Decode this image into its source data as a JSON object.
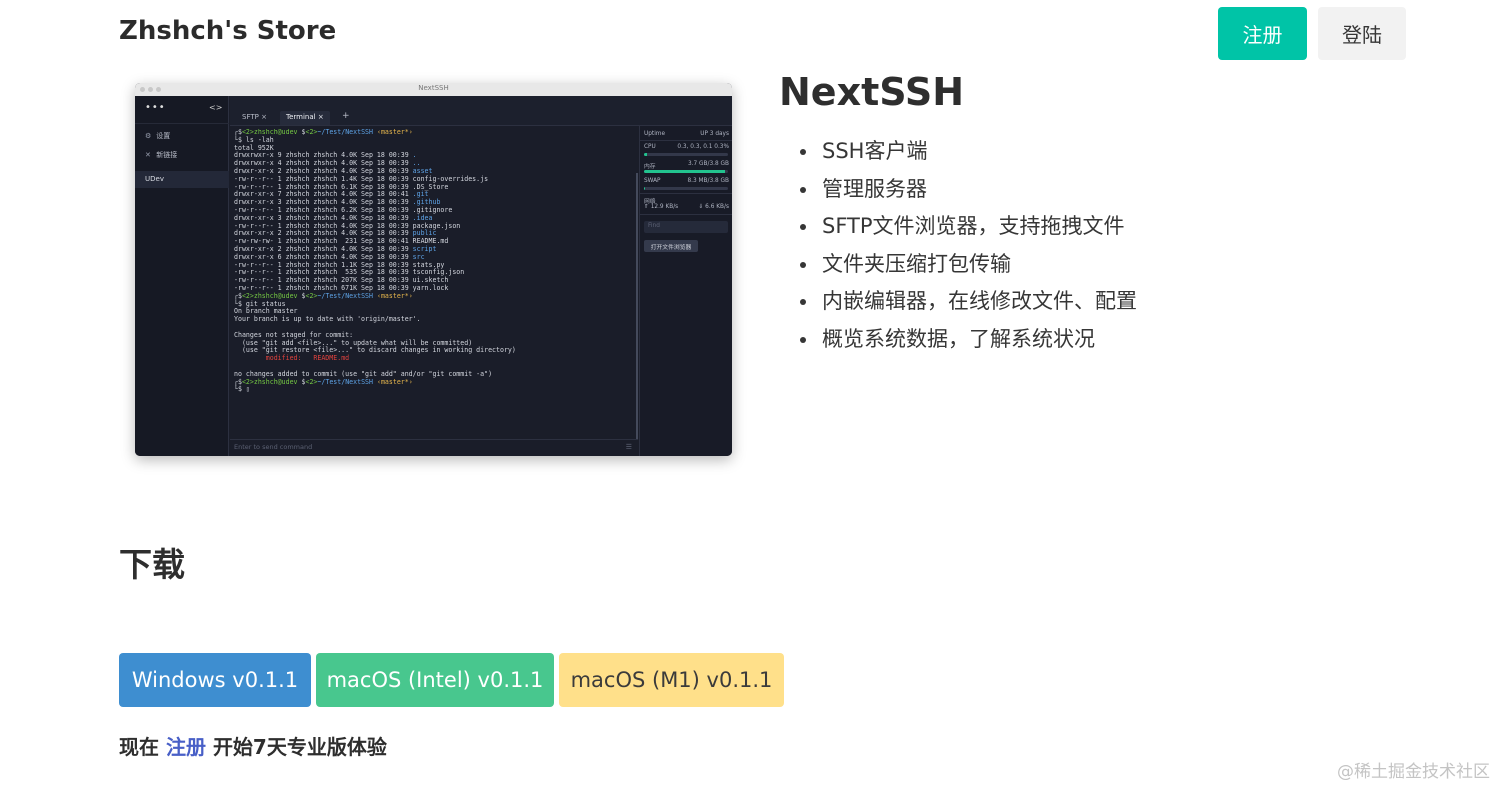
{
  "header": {
    "brand": "Zhshch's Store",
    "register_label": "注册",
    "login_label": "登陆"
  },
  "screenshot": {
    "window_title": "NextSSH",
    "sidebar": {
      "menu_dots": "•••",
      "items": [
        {
          "icon": "gear-icon",
          "label": "设置"
        },
        {
          "icon": "link-icon",
          "label": "新链接"
        }
      ],
      "connection": "UDev"
    },
    "tabs": [
      {
        "label": "SFTP",
        "close": "×"
      },
      {
        "label": "Terminal",
        "close": "×"
      }
    ],
    "add_tab": "+",
    "input_placeholder": "Enter to send command",
    "panel": {
      "uptime_label": "Uptime",
      "uptime_value": "UP 3 days",
      "cpu_label": "CPU",
      "cpu_value": "0.3, 0.3, 0.1 0.3%",
      "cpu_level": 0.03,
      "mem_label": "内存",
      "mem_value": "3.7 GB/3.8 GB",
      "mem_level": 0.97,
      "swap_label": "SWAP",
      "swap_value": "8.3 MB/3.8 GB",
      "swap_level": 0.01,
      "net_label": "网络",
      "net_up": "12.9 KB/s",
      "net_down": "6.6 KB/s",
      "find_placeholder": "Find",
      "open_browser": "打开文件浏览器"
    }
  },
  "product": {
    "title": "NextSSH",
    "features": [
      "SSH客户端",
      "管理服务器",
      "SFTP文件浏览器，支持拖拽文件",
      "文件夹压缩打包传输",
      "内嵌编辑器，在线修改文件、配置",
      "概览系统数据，了解系统状况"
    ]
  },
  "download": {
    "title": "下载",
    "windows": "Windows v0.1.1",
    "mac_intel": "macOS (Intel) v0.1.1",
    "mac_m1": "macOS (M1) v0.1.1"
  },
  "trial": {
    "prefix": "现在",
    "link": "注册",
    "suffix": "开始7天专业版体验"
  },
  "watermark": "@稀土掘金技术社区",
  "colors": {
    "primary": "#00c4a7",
    "info": "#3e8ed0",
    "success": "#48c78e",
    "warning": "#ffe08a",
    "link": "#485fc7"
  }
}
